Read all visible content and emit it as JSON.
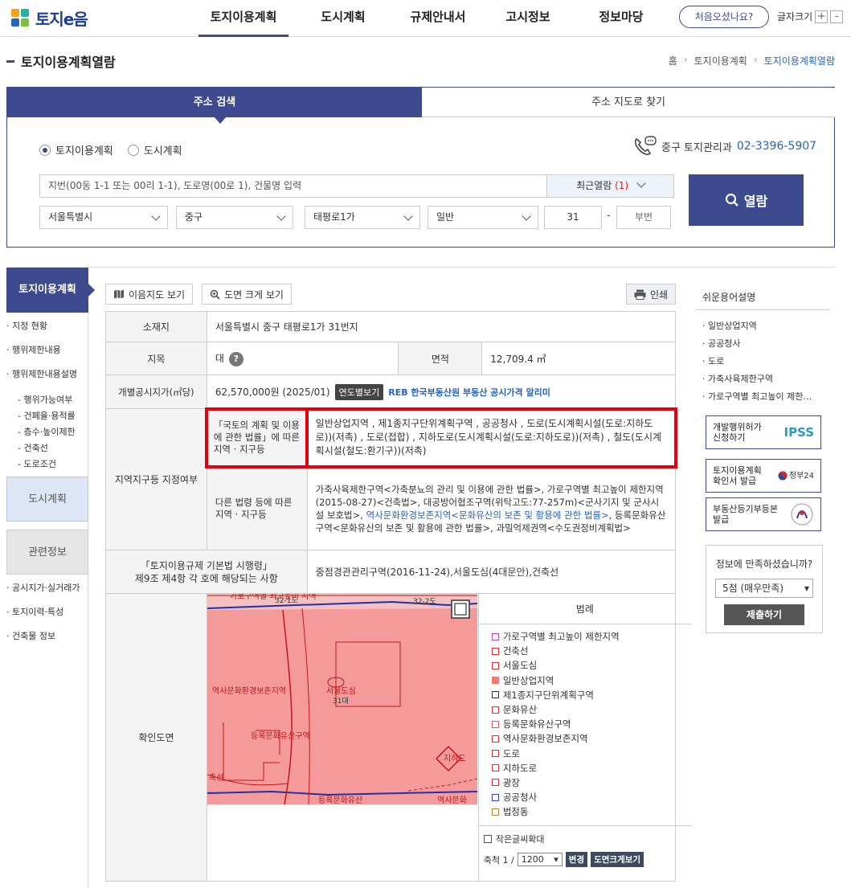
{
  "header": {
    "logo_text": "토지e음",
    "nav": [
      "토지이용계획",
      "도시계획",
      "규제안내서",
      "고시정보",
      "정보마당"
    ],
    "first_visit": "처음오셨나요?",
    "font_size_label": "글자크기",
    "plus": "+",
    "minus": "-"
  },
  "page": {
    "title": "토지이용계획열람",
    "breadcrumb": [
      "홈",
      "토지이용계획",
      "토지이용계획열람"
    ]
  },
  "search": {
    "tabs": [
      "주소 검색",
      "주소 지도로 찾기"
    ],
    "radios": [
      "토지이용계획",
      "도시계획"
    ],
    "selected_radio": "토지이용계획",
    "contact_label": "중구 토지관리과",
    "contact_phone": "02-3396-5907",
    "placeholder": "지번(00동 1-1 또는 00리 1-1), 도로명(00로 1), 건물명 입력",
    "recent_label": "최근열람",
    "recent_count": "(1)",
    "selects": [
      "서울특별시",
      "중구",
      "태평로1가",
      "일반"
    ],
    "main_no": "31",
    "dash": "-",
    "sub_no": "부번",
    "button": "열람"
  },
  "lnb": {
    "head": "토지이용계획",
    "items": [
      "· 지정 현황",
      "· 행위제한내용",
      "· 행위제한내용설명"
    ],
    "subs": [
      "- 행위가능여부",
      "- 건폐율·용적률",
      "- 층수·높이제한",
      "- 건축선",
      "- 도로조건"
    ],
    "block1": "도시계획",
    "block2": "관련정보",
    "items2": [
      "· 공시지가·실거래가",
      "· 토지이력·특성",
      "· 건축물 정보"
    ]
  },
  "toolbar": {
    "map_btn": "이음지도 보기",
    "zoom_btn": "도면 크게 보기",
    "print_btn": "인쇄"
  },
  "info": {
    "location_label": "소재지",
    "location": "서울특별시 중구 태평로1가 31번지",
    "jimok_label": "지목",
    "jimok": "대",
    "area_label": "면적",
    "area": "12,709.4 ㎡",
    "price_label": "개별공시지가(㎡당)",
    "price": "62,570,000원 (2025/01)",
    "price_btn": "연도별보기",
    "reb_text": "REB 한국부동산원 부동산 공시가격 알리미",
    "zone_label": "지역지구등 지정여부",
    "law1_label": "「국토의 계획 및 이용에 관한 법률」에 따른 지역 · 지구등",
    "law1_value": "일반상업지역 , 제1종지구단위계획구역 , 공공청사 , 도로(도시계획시설(도로:지하도로))(저촉) , 도로(접합) , 지하도로(도시계획시설(도로:지하도로))(저촉) , 철도(도시계획시설(철도:환기구))(저촉)",
    "law2_label": "다른 법령 등에 따른 지역 · 지구등",
    "law2_value_a": "가축사육제한구역<가축분뇨의 관리 및 이용에 관한 법률>, 가로구역별 최고높이 제한지역(2015-08-27)<건축법>, 대공방어협조구역(위탁고도:77-257m)<군사기지 및 군사시설 보호법>, ",
    "law2_value_link": "역사문화환경보존지역<문화유산의 보존 및 활용에 관한 법률>",
    "law2_value_b": ", 등록문화유산구역<문화유산의 보존 및 활용에 관한 법률>, 과밀억제권역<수도권정비계획법>",
    "basic_law_label_1": "「토지이용규제 기본법 시행령」",
    "basic_law_label_2": "제9조 제4항 각 호에 해당되는 사항",
    "basic_law_value": "중점경관관리구역(2016-11-24),서울도심(4대문안),건축선",
    "map_label": "확인도면"
  },
  "map_labels": [
    "가로구역별 최고높이 지역",
    "32-1도",
    "32-2도",
    "역사문화환경보존지역",
    "서울도심",
    "31대",
    "등록문화유산구역",
    "지하도",
    "축선",
    "역사문화",
    "등록문화유산"
  ],
  "legend": {
    "title": "범례",
    "items": [
      "가로구역별 최고높이 제한지역",
      "건축선",
      "서울도심",
      "일반상업지역",
      "제1종지구단위계획구역",
      "문화유산",
      "등록문화유산구역",
      "역사문화환경보존지역",
      "도로",
      "지하도로",
      "광장",
      "공공청사",
      "법정동"
    ],
    "colors": [
      "#b946b9",
      "#d33",
      "#d33",
      "#f07a7a",
      "#333",
      "#d33",
      "#e25a5a",
      "#d33",
      "#d33",
      "#d33",
      "#d33",
      "#3344aa",
      "#b08a40"
    ],
    "small_text": "작은글씨확대",
    "scale_label": "축척 1 /",
    "scale_value": "1200",
    "change_btn": "변경",
    "zoom_btn": "도면크게보기"
  },
  "right": {
    "title": "쉬운용어설명",
    "terms": [
      "일반상업지역",
      "공공청사",
      "도로",
      "가축사육제한구역",
      "가로구역별 최고높이 제한…"
    ],
    "banner1": "개발행위허가 신청하기",
    "banner1_logo": "IPSS",
    "banner2": "토지이용계획 확인서 발급",
    "banner2_logo": "정부24",
    "banner3": "부동산등기부등본 발급",
    "survey_q": "정보에 만족하셨습니까?",
    "survey_value": "5점 (매우만족)",
    "survey_btn": "제출하기"
  }
}
